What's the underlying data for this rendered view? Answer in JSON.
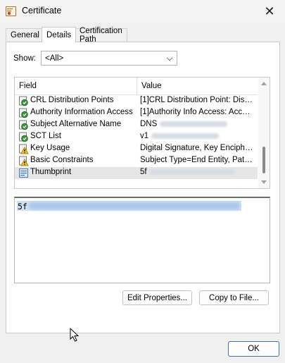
{
  "window": {
    "title": "Certificate",
    "close_glyph": "✕"
  },
  "tabs": [
    {
      "label": "General",
      "active": false
    },
    {
      "label": "Details",
      "active": true
    },
    {
      "label": "Certification Path",
      "active": false
    }
  ],
  "show": {
    "label": "Show:",
    "selected": "<All>"
  },
  "columns": {
    "field": "Field",
    "value": "Value"
  },
  "rows": [
    {
      "field": "CRL Distribution Points",
      "value": "[1]CRL Distribution Point: Distr…",
      "icon": "ext-cert-icon",
      "selected": false
    },
    {
      "field": "Authority Information Access",
      "value": "[1]Authority Info Access: Acc…",
      "icon": "ext-cert-icon",
      "selected": false
    },
    {
      "field": "Subject Alternative Name",
      "value": "DNS",
      "icon": "ext-cert-icon",
      "selected": false
    },
    {
      "field": "SCT List",
      "value": "v1",
      "icon": "ext-cert-icon",
      "selected": false
    },
    {
      "field": "Key Usage",
      "value": "Digital Signature, Key Encipher…",
      "icon": "critical-ext-icon",
      "selected": false
    },
    {
      "field": "Basic Constraints",
      "value": "Subject Type=End Entity, Pat…",
      "icon": "critical-ext-icon",
      "selected": false
    },
    {
      "field": "Thumbprint",
      "value": "5f",
      "icon": "property-icon",
      "selected": true
    }
  ],
  "detail": {
    "text": "5f"
  },
  "buttons": {
    "edit_properties": "Edit Properties...",
    "copy_to_file": "Copy to File...",
    "ok": "OK"
  },
  "colors": {
    "selection": "#cfe0f5",
    "ok_border": "#3e6fb0",
    "row_selected": "#e6e6e6"
  }
}
